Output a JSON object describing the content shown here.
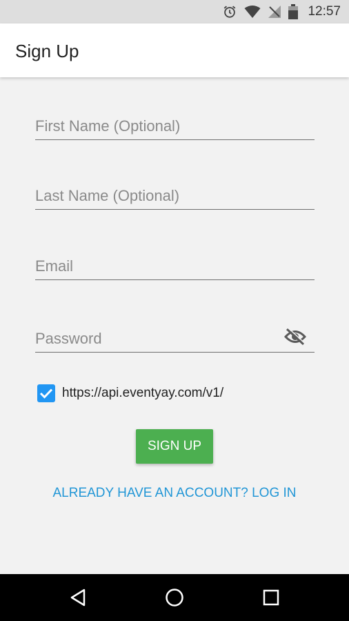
{
  "status_bar": {
    "time": "12:57",
    "icons": [
      "alarm-icon",
      "wifi-icon",
      "no-signal-icon",
      "battery-icon"
    ]
  },
  "app_bar": {
    "title": "Sign Up"
  },
  "form": {
    "first_name": {
      "placeholder": "First Name (Optional)",
      "value": ""
    },
    "last_name": {
      "placeholder": "Last Name (Optional)",
      "value": ""
    },
    "email": {
      "placeholder": "Email",
      "value": ""
    },
    "password": {
      "placeholder": "Password",
      "value": "",
      "toggle_icon": "visibility-off-icon"
    },
    "api_checkbox": {
      "checked": true,
      "label": "https://api.eventyay.com/v1/"
    },
    "signup_label": "SIGN UP",
    "login_link": "ALREADY HAVE AN ACCOUNT? LOG IN"
  },
  "nav_bar": {
    "icons": [
      "back-icon",
      "home-icon",
      "recents-icon"
    ]
  },
  "colors": {
    "accent": "#2196f3",
    "button": "#4caf50",
    "link": "#2196d6",
    "background": "#f2f2f2"
  }
}
